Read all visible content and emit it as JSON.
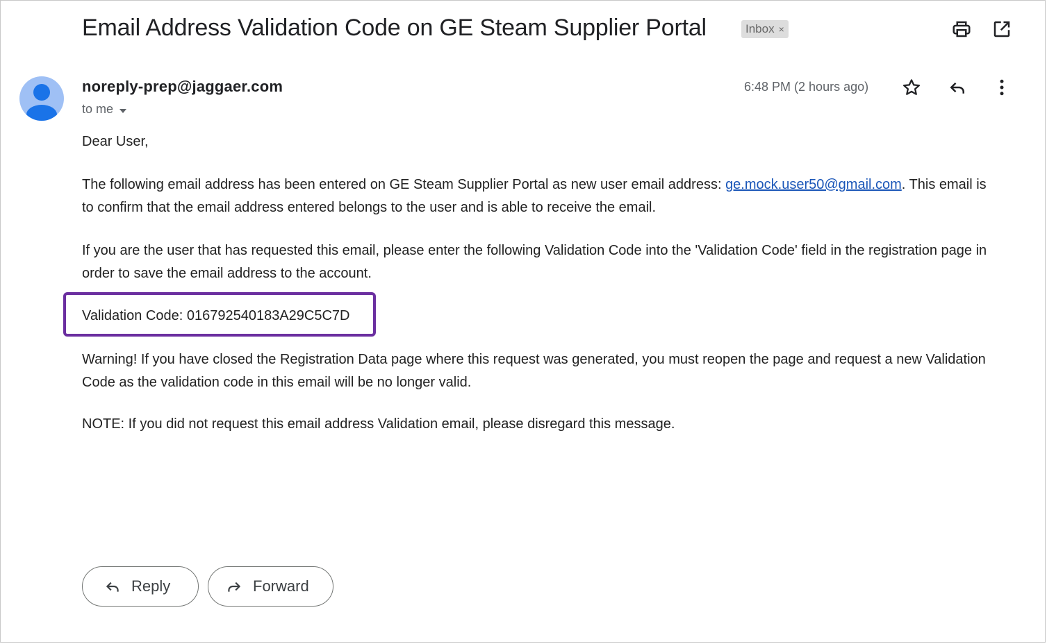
{
  "email": {
    "subject": "Email Address Validation Code on GE Steam Supplier Portal",
    "label_chip": "Inbox",
    "label_chip_close": "×",
    "sender": "noreply-prep@jaggaer.com",
    "recipient": "to me",
    "time": "6:48 PM (2 hours ago)",
    "body": {
      "greeting": "Dear User,",
      "para1_before": "The following email address has been entered on GE Steam Supplier Portal as new user email address: ",
      "para1_link": "ge.mock.user50@gmail.com",
      "para1_after": ".  This email is to confirm that the email address entered belongs to the user and is able to receive the email.",
      "para2": "If you are the user that has requested this email, please enter the following Validation Code into the 'Validation Code' field in the registration page in order to save the email address to the account.",
      "validation_code": "Validation Code: 016792540183A29C5C7D",
      "warning": "Warning! If you have closed the Registration Data page where this request was generated, you must reopen the page and request a new Validation Code as the validation code in this email will be no longer valid.",
      "note": "NOTE:  If you did not request this email address Validation email, please disregard this message."
    },
    "actions": {
      "reply_label": "Reply",
      "forward_label": "Forward"
    }
  },
  "icons": {
    "print": "print-icon",
    "open_in_new": "open-in-new-window-icon",
    "star": "star-icon",
    "reply": "reply-icon",
    "more": "more-vertical-icon",
    "forward": "forward-icon",
    "avatar": "default-avatar-icon",
    "caret": "caret-down-icon"
  },
  "colors": {
    "link": "#1a56b8",
    "highlight_border": "#6b2fa0",
    "avatar_bg": "#9fc0f5",
    "avatar_fg": "#1a73e8",
    "chip_bg": "#dddddd"
  }
}
